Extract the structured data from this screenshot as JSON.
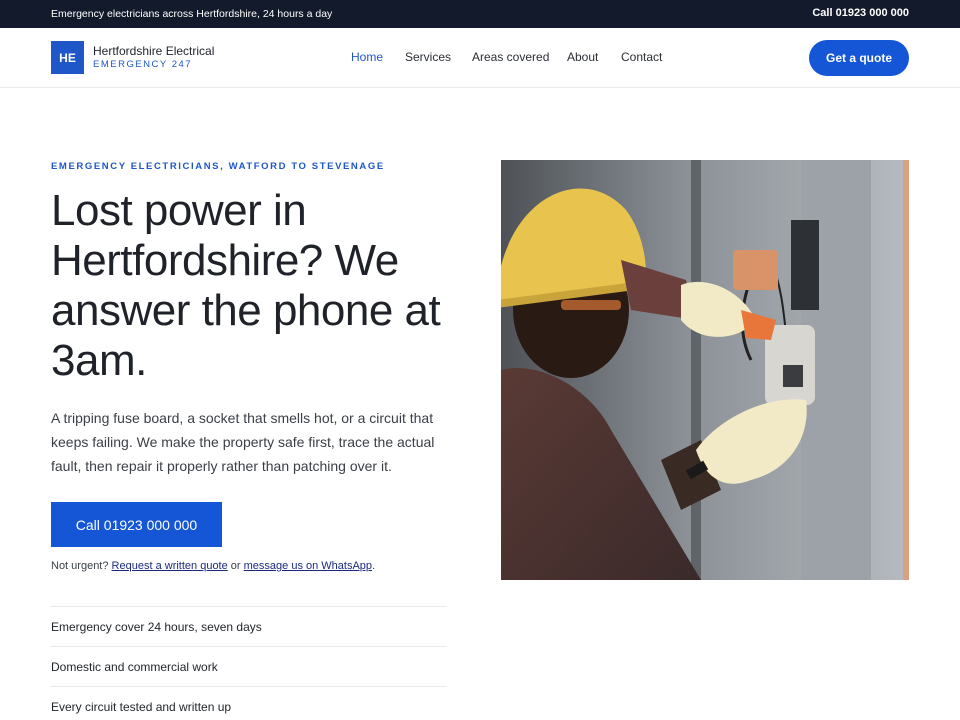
{
  "topbar": {
    "tagline": "Emergency electricians across Hertfordshire, 24 hours a day",
    "phone": "Call 01923 000 000"
  },
  "header": {
    "logo_initials": "HE",
    "brand_name": "Hertfordshire Electrical",
    "brand_sub": "EMERGENCY 247",
    "nav": [
      "Home",
      "Services",
      "Areas covered",
      "About",
      "Contact"
    ],
    "active_nav": "Home",
    "cta": "Get a quote"
  },
  "hero": {
    "eyebrow": "EMERGENCY ELECTRICIANS, WATFORD TO STEVENAGE",
    "headline": "Lost power in Hertfordshire? We answer the phone at 3am.",
    "lede": "A tripping fuse board, a socket that smells hot, or a circuit that keeps failing. We make the property safe first, trace the actual fault, then repair it properly rather than patching over it.",
    "call_button": "Call 01923 000 000",
    "alt_prefix": "Not urgent?",
    "alt_link_1": "Request a written quote",
    "alt_mid": "or",
    "alt_link_2": "message us on WhatsApp",
    "alt_suffix": ".",
    "features": [
      "Emergency cover 24 hours, seven days",
      "Domestic and commercial work",
      "Every circuit tested and written up"
    ]
  },
  "colors": {
    "accent": "#1456d6",
    "topbar_bg": "#121a2b",
    "link": "#1b2a80"
  }
}
